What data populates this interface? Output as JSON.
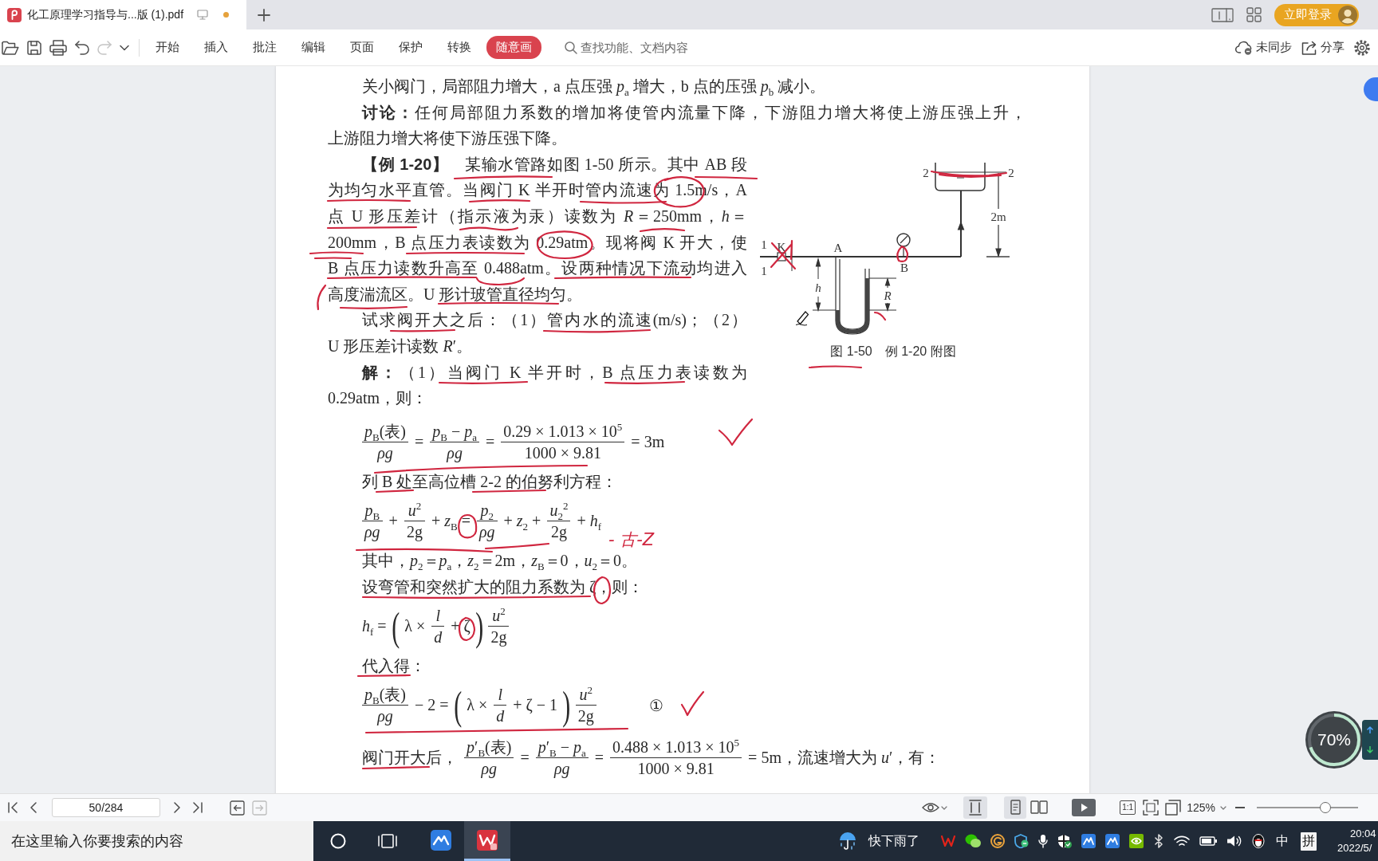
{
  "tab_bar": {
    "tabs": [
      {
        "title": "化工原理学习指导与...版 (1).pdf",
        "selected": true,
        "modified": true
      }
    ],
    "login_button": "立即登录"
  },
  "toolbar": {
    "redo_disabled": true,
    "menu": [
      {
        "label": "开始",
        "selected": false
      },
      {
        "label": "插入",
        "selected": false
      },
      {
        "label": "批注",
        "selected": false
      },
      {
        "label": "编辑",
        "selected": false
      },
      {
        "label": "页面",
        "selected": false
      },
      {
        "label": "保护",
        "selected": false
      },
      {
        "label": "转换",
        "selected": false
      },
      {
        "label": "随意画",
        "selected": true
      }
    ],
    "search": {
      "placeholder": "查找功能、文档内容"
    },
    "sync_button": "未同步",
    "share_button": "分享"
  },
  "page": {
    "intro": [
      {
        "lines": [
          "关小阀门，局部阻力增大，a 点压强 *p*$_{a}$ 增大，b 点的压强 *p*$_{b}$ 减小。"
        ]
      },
      {
        "lines": [
          "**讨论：**任何局部阻力系数的增加将使管内流量下降，下游阻力增大将使上游压强上升，",
          "上游阻力增大将使下游压强下降。"
        ]
      }
    ],
    "example": {
      "text": [
        {
          "lines": [
            "**【例 1-20】**　某输水管路如图 1-50 所示。其中 AB 段",
            "为均匀水平直管。当阀门 K 半开时管内流速为 1.5m/s，A",
            "点 U 形压差计（指示液为汞）读数为 *R*＝250mm，*h*＝",
            "200mm，B 点压力表读数为 0.29atm。现将阀 K 开大，使",
            "B 点压力读数升高至 0.488atm。设两种情况下流动均进入",
            "高度湍流区。U 形计玻管直径均匀。"
          ]
        },
        {
          "lines": [
            "试求阀开大之后：（1）管内水的流速(m/s)；（2）",
            "U 形压差计读数 *R*′。"
          ]
        },
        {
          "lines": [
            "**解：**（1）当阀门 K 半开时，B 点压力表读数为",
            "0.29atm，则："
          ]
        }
      ],
      "figure": {
        "labels": [
          "1",
          "K",
          "1",
          "A",
          "B",
          "h",
          "R",
          "2m",
          "2",
          "2"
        ],
        "caption": "图 1-50　例 1-20 附图"
      }
    },
    "solution": [
      {
        "kind": "equation",
        "parts": [
          {
            "kind": "frac",
            "num": "*p*$_{B}$(表)",
            "den": "*ρg*"
          },
          {
            "kind": "text",
            "text": "="
          },
          {
            "kind": "frac",
            "num": "*p*$_{B}$ − *p*$_{a}$",
            "den": "*ρg*"
          },
          {
            "kind": "text",
            "text": "="
          },
          {
            "kind": "frac",
            "num": "0.29 × 1.013 × 10$^{5}$",
            "den": "1000 × 9.81"
          },
          {
            "kind": "text",
            "text": "= 3m"
          }
        ]
      },
      {
        "kind": "line",
        "text": "列 B 处至高位槽 2-2 的伯努利方程："
      },
      {
        "kind": "equation",
        "parts": [
          {
            "kind": "frac",
            "num": "*p*$_{B}$",
            "den": "*ρg*"
          },
          {
            "kind": "text",
            "text": "+"
          },
          {
            "kind": "frac",
            "num": "*u*$^{2}$",
            "den": "2g"
          },
          {
            "kind": "text",
            "text": "+ *z*$_{B}$ ="
          },
          {
            "kind": "frac",
            "num": "*p*$_{2}$",
            "den": "*ρg*"
          },
          {
            "kind": "text",
            "text": "+ *z*$_{2}$ +"
          },
          {
            "kind": "frac",
            "num": "*u*$_{2}$$^{2}$",
            "den": "2g"
          },
          {
            "kind": "text",
            "text": "+ *h*$_{f}$"
          }
        ]
      },
      {
        "kind": "line",
        "text": "其中，*p*$_{2}$＝*p*$_{a}$，*z*$_{2}$＝2m，*z*$_{B}$＝0，*u*$_{2}$＝0。"
      },
      {
        "kind": "line",
        "text": "设弯管和突然扩大的阻力系数为 ζ，则："
      },
      {
        "kind": "equation",
        "parts": [
          {
            "kind": "text",
            "text": "*h*$_{f}$ ="
          },
          {
            "kind": "paren",
            "text": "("
          },
          {
            "kind": "text",
            "text": "λ ×"
          },
          {
            "kind": "frac",
            "num": "*l*",
            "den": "*d*"
          },
          {
            "kind": "text",
            "text": "+ ζ"
          },
          {
            "kind": "paren",
            "text": ")"
          },
          {
            "kind": "frac",
            "num": "*u*$^{2}$",
            "den": "2g"
          }
        ]
      },
      {
        "kind": "line",
        "text": "代入得："
      },
      {
        "kind": "equation",
        "parts": [
          {
            "kind": "frac",
            "num": "*p*$_{B}$(表)",
            "den": "*ρg*"
          },
          {
            "kind": "text",
            "text": "− 2 ="
          },
          {
            "kind": "paren",
            "text": "("
          },
          {
            "kind": "text",
            "text": "λ ×"
          },
          {
            "kind": "frac",
            "num": "*l*",
            "den": "*d*"
          },
          {
            "kind": "text",
            "text": "+ ζ − 1"
          },
          {
            "kind": "paren",
            "text": ")"
          },
          {
            "kind": "frac",
            "num": "*u*$^{2}$",
            "den": "2g"
          },
          {
            "kind": "mark",
            "text": "①"
          }
        ]
      },
      {
        "kind": "equation",
        "parts": [
          {
            "kind": "text",
            "text": "阀门开大后，"
          },
          {
            "kind": "frac",
            "num": "*p*′$_{B}$(表)",
            "den": "*ρg*"
          },
          {
            "kind": "text",
            "text": "="
          },
          {
            "kind": "frac",
            "num": "*p*′$_{B}$ − *p*$_{a}$",
            "den": "*ρg*"
          },
          {
            "kind": "text",
            "text": "="
          },
          {
            "kind": "frac",
            "num": "0.488 × 1.013 × 10$^{5}$",
            "den": "1000 × 9.81"
          },
          {
            "kind": "text",
            "text": "= 5m，流速增大为 *u*′，有："
          }
        ]
      }
    ],
    "handwritten_note": "- 古-Z"
  },
  "status_bar": {
    "page_field": {
      "value": "50/284"
    },
    "forward_disabled": true,
    "scroll_mode_on": true,
    "page_layouts": [
      {
        "selected": true
      },
      {
        "selected": false
      }
    ],
    "actual_size": "1:1",
    "zoom": {
      "reading": "125%",
      "level": 0.68
    }
  },
  "speed_ball": {
    "reading": "70%",
    "level": 0.7
  },
  "taskbar": {
    "search": {
      "placeholder": "在这里输入你要搜索的内容"
    },
    "apps": [
      {
        "selected": false
      },
      {
        "selected": true
      }
    ],
    "weather": "快下雨了",
    "input_indicators": [
      "中",
      "拼"
    ],
    "time": "20:04",
    "date": "2022/5/"
  }
}
